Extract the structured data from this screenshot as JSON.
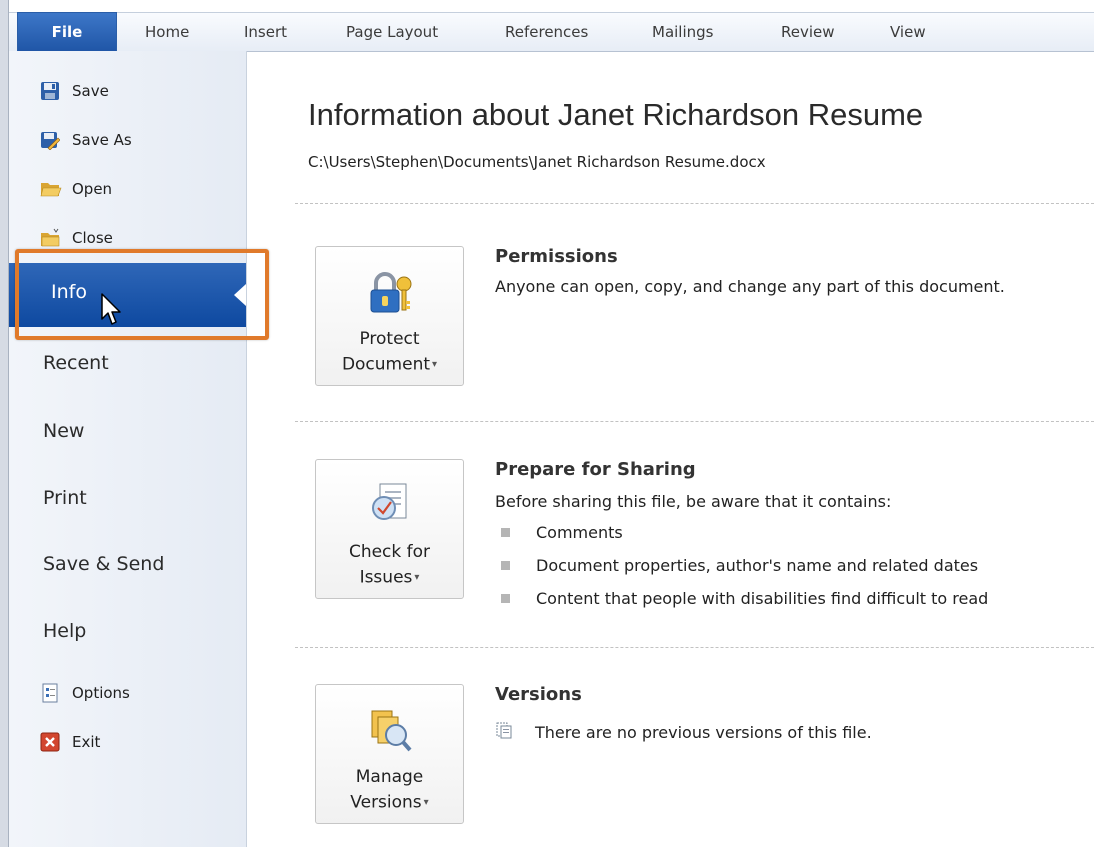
{
  "ribbon": {
    "tabs": [
      "File",
      "Home",
      "Insert",
      "Page Layout",
      "References",
      "Mailings",
      "Review",
      "View"
    ],
    "active_tab": "File"
  },
  "backstage_nav": {
    "commands": [
      {
        "label": "Save",
        "icon": "save-icon"
      },
      {
        "label": "Save As",
        "icon": "save-as-icon"
      },
      {
        "label": "Open",
        "icon": "open-folder-icon"
      },
      {
        "label": "Close",
        "icon": "close-folder-icon"
      }
    ],
    "selected": "Info",
    "items": [
      "Recent",
      "New",
      "Print",
      "Save & Send",
      "Help"
    ],
    "bottom_commands": [
      {
        "label": "Options",
        "icon": "options-icon"
      },
      {
        "label": "Exit",
        "icon": "exit-icon"
      }
    ],
    "selected_color": "#1a55a8",
    "highlight_color": "#e07a2b"
  },
  "main": {
    "title": "Information about Janet Richardson Resume",
    "path": "C:\\Users\\Stephen\\Documents\\Janet Richardson Resume.docx",
    "permissions": {
      "button_line1": "Protect",
      "button_line2": "Document",
      "heading": "Permissions",
      "text": "Anyone can open, copy, and change any part of this document."
    },
    "sharing": {
      "button_line1": "Check for",
      "button_line2": "Issues",
      "heading": "Prepare for Sharing",
      "text": "Before sharing this file, be aware that it contains:",
      "bullets": [
        "Comments",
        "Document properties, author's name and related dates",
        "Content that people with disabilities find difficult to read"
      ]
    },
    "versions": {
      "button_line1": "Manage",
      "button_line2": "Versions",
      "heading": "Versions",
      "text": "There are no previous versions of this file."
    }
  }
}
